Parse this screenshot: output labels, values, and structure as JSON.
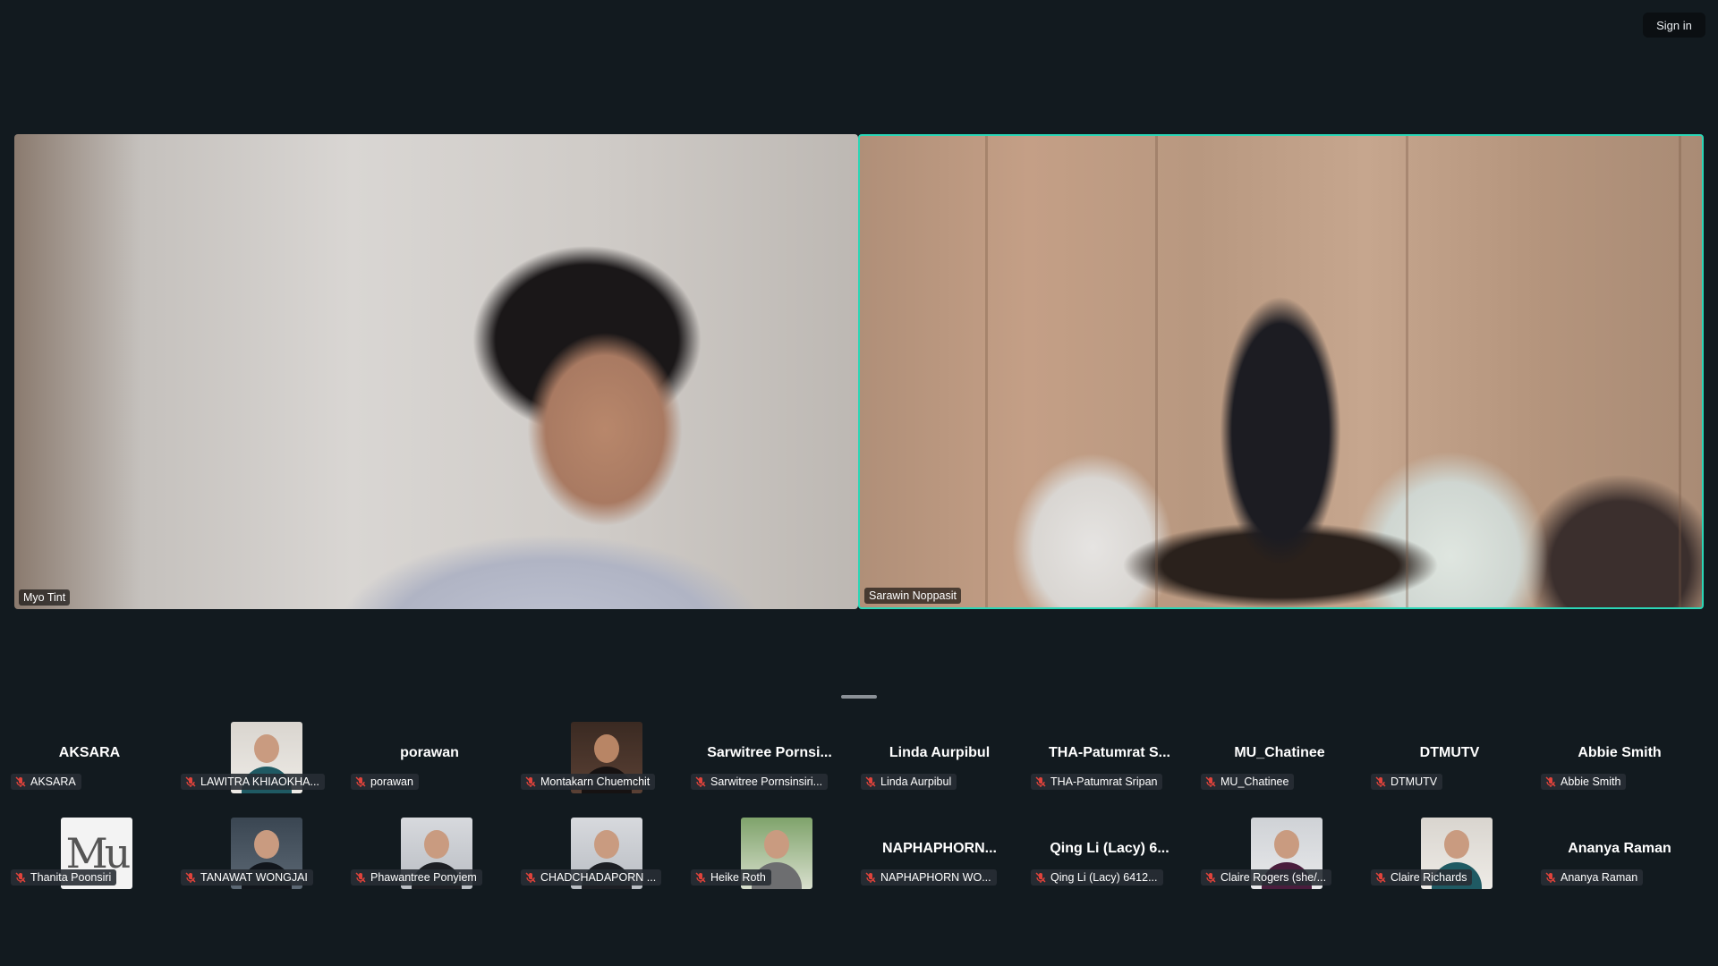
{
  "header": {
    "sign_in_label": "Sign in"
  },
  "main_videos": [
    {
      "name": "Myo Tint"
    },
    {
      "name": "Sarawin Noppasit"
    }
  ],
  "gallery": {
    "row1": [
      {
        "display": "AKSARA",
        "tag": "AKSARA"
      },
      {
        "display": "",
        "tag": "LAWITRA KHIAOKHA..."
      },
      {
        "display": "porawan",
        "tag": "porawan"
      },
      {
        "display": "",
        "tag": "Montakarn Chuemchit"
      },
      {
        "display": "Sarwitree  Pornsi...",
        "tag": "Sarwitree Pornsinsiri..."
      },
      {
        "display": "Linda Aurpibul",
        "tag": "Linda Aurpibul"
      },
      {
        "display": "THA-Patumrat  S...",
        "tag": "THA-Patumrat Sripan"
      },
      {
        "display": "MU_Chatinee",
        "tag": "MU_Chatinee"
      },
      {
        "display": "DTMUTV",
        "tag": "DTMUTV"
      },
      {
        "display": "Abbie Smith",
        "tag": "Abbie Smith"
      }
    ],
    "row2": [
      {
        "display": "",
        "tag": "Thanita Poonsiri",
        "logo_text": "Mu"
      },
      {
        "display": "",
        "tag": "TANAWAT WONGJAI"
      },
      {
        "display": "",
        "tag": "Phawantree Ponyiem"
      },
      {
        "display": "",
        "tag": "CHADCHADAPORN ..."
      },
      {
        "display": "",
        "tag": "Heike Roth"
      },
      {
        "display": "NAPHAPHORN...",
        "tag": "NAPHAPHORN WO..."
      },
      {
        "display": "Qing Li (Lacy) 6...",
        "tag": "Qing Li (Lacy) 6412..."
      },
      {
        "display": "",
        "tag": "Claire Rogers (she/..."
      },
      {
        "display": "",
        "tag": "Claire Richards"
      },
      {
        "display": "Ananya Raman",
        "tag": "Ananya Raman"
      }
    ]
  },
  "colors": {
    "background": "#121a1f",
    "active_speaker": "#2bd6b6",
    "mute": "#e0433b"
  },
  "icons": {
    "mute": "microphone-muted-icon"
  }
}
